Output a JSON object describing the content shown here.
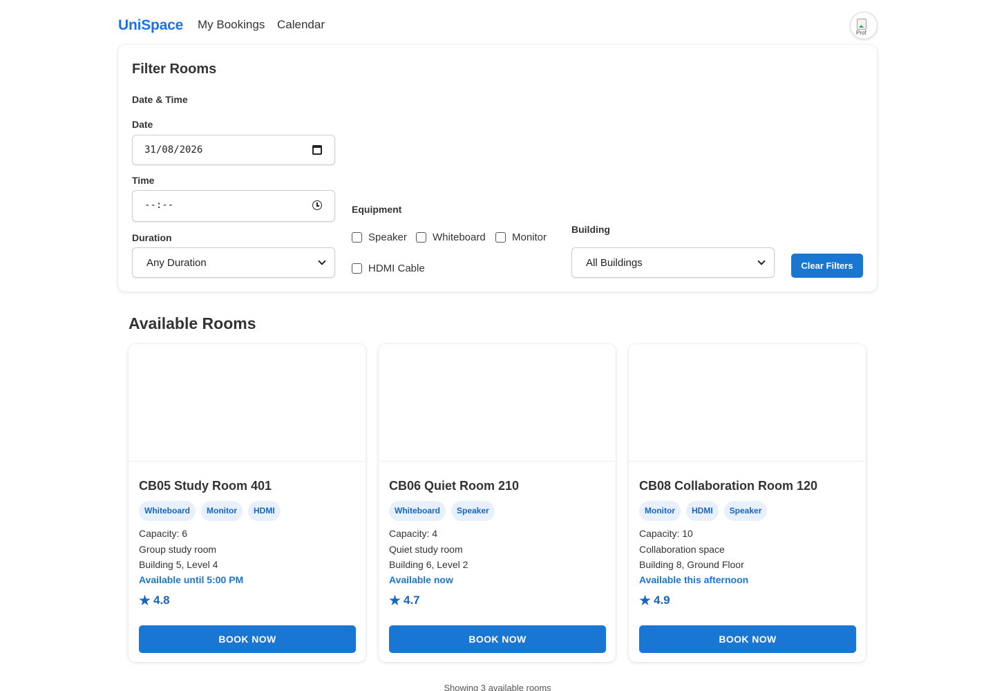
{
  "nav": {
    "logo": "UniSpace",
    "links": [
      "My Bookings",
      "Calendar"
    ],
    "avatar_alt": "Prof"
  },
  "filters": {
    "title": "Filter Rooms",
    "datetime_label": "Date & Time",
    "date_label": "Date",
    "date_value": "31/08/2026",
    "time_label": "Time",
    "time_value": "--:--",
    "duration_label": "Duration",
    "duration_value": "Any Duration",
    "equipment_label": "Equipment",
    "equipment_options": [
      {
        "label": "Speaker",
        "checked": false
      },
      {
        "label": "Whiteboard",
        "checked": false
      },
      {
        "label": "Monitor",
        "checked": false
      },
      {
        "label": "HDMI Cable",
        "checked": false
      }
    ],
    "building_label": "Building",
    "building_value": "All Buildings",
    "clear_label": "Clear Filters"
  },
  "rooms": {
    "title": "Available Rooms",
    "items": [
      {
        "name": "CB05 Study Room 401",
        "tags": [
          "Whiteboard",
          "Monitor",
          "HDMI"
        ],
        "capacity": "Capacity: 6",
        "type": "Group study room",
        "location": "Building 5, Level 4",
        "availability": "Available until 5:00 PM",
        "rating": "4.8",
        "button": "BOOK NOW"
      },
      {
        "name": "CB06 Quiet Room 210",
        "tags": [
          "Whiteboard",
          "Speaker"
        ],
        "capacity": "Capacity: 4",
        "type": "Quiet study room",
        "location": "Building 6, Level 2",
        "availability": "Available now",
        "rating": "4.7",
        "button": "BOOK NOW"
      },
      {
        "name": "CB08 Collaboration Room 120",
        "tags": [
          "Monitor",
          "HDMI",
          "Speaker"
        ],
        "capacity": "Capacity: 10",
        "type": "Collaboration space",
        "location": "Building 8, Ground Floor",
        "availability": "Available this afternoon",
        "rating": "4.9",
        "button": "BOOK NOW"
      }
    ],
    "count_text": "Showing 3 available rooms"
  },
  "colors": {
    "accent": "#1976d2",
    "logo": "#1a73e8",
    "tag_bg": "#e8f0fb",
    "tag_text": "#1565c0"
  }
}
